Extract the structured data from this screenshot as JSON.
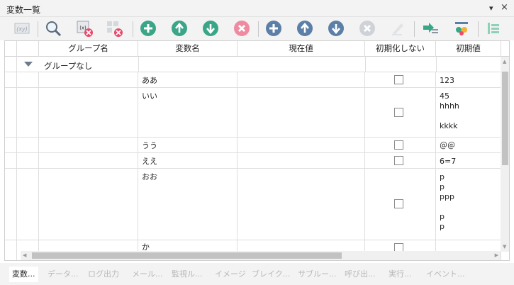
{
  "panel": {
    "title": "変数一覧",
    "dropdown_icon": "▾",
    "close_icon": "×"
  },
  "toolbar": {
    "buttons": [
      {
        "name": "variable-xy-icon",
        "label": "(xy)"
      },
      {
        "name": "search-icon"
      },
      {
        "name": "clear-variable-icon",
        "label": "(x)"
      },
      {
        "name": "clear-grid-icon"
      },
      {
        "name": "add-icon"
      },
      {
        "name": "move-up-icon"
      },
      {
        "name": "move-down-icon"
      },
      {
        "name": "delete-icon"
      },
      {
        "name": "add-group-icon"
      },
      {
        "name": "group-up-icon"
      },
      {
        "name": "group-down-icon"
      },
      {
        "name": "group-delete-icon"
      },
      {
        "name": "edit-icon"
      },
      {
        "name": "import-icon"
      },
      {
        "name": "settings-icon"
      },
      {
        "name": "collapse-icon"
      }
    ]
  },
  "grid": {
    "columns": [
      "グループ名",
      "変数名",
      "現在値",
      "初期化しない",
      "初期値"
    ],
    "group": {
      "label": "グループなし"
    },
    "rows": [
      {
        "name": "ああ",
        "current": "",
        "no_init": false,
        "initial": "123"
      },
      {
        "name": "いい",
        "current": "",
        "no_init": false,
        "initial": "45\nhhhh\n\nkkkk"
      },
      {
        "name": "うう",
        "current": "",
        "no_init": false,
        "initial": "＠＠"
      },
      {
        "name": "ええ",
        "current": "",
        "no_init": false,
        "initial": "6=7"
      },
      {
        "name": "おお",
        "current": "",
        "no_init": false,
        "initial": "p\np\nppp\n\np\np"
      },
      {
        "name": "か",
        "current": "",
        "no_init": false,
        "initial": ""
      }
    ]
  },
  "tabs": [
    {
      "label": "変数...",
      "active": true
    },
    {
      "label": "データ...",
      "active": false
    },
    {
      "label": "ログ出力",
      "active": false
    },
    {
      "label": "メール...",
      "active": false
    },
    {
      "label": "監視ル...",
      "active": false
    },
    {
      "label": "イメージ",
      "active": false
    },
    {
      "label": "ブレイク...",
      "active": false
    },
    {
      "label": "サブルー...",
      "active": false
    },
    {
      "label": "呼び出...",
      "active": false
    },
    {
      "label": "実行...",
      "active": false
    },
    {
      "label": "イベント...",
      "active": false
    }
  ],
  "colors": {
    "green": "#3aa687",
    "blue": "#5c7fa8",
    "pink": "#f08aa0",
    "gray": "#cfd3d8"
  }
}
